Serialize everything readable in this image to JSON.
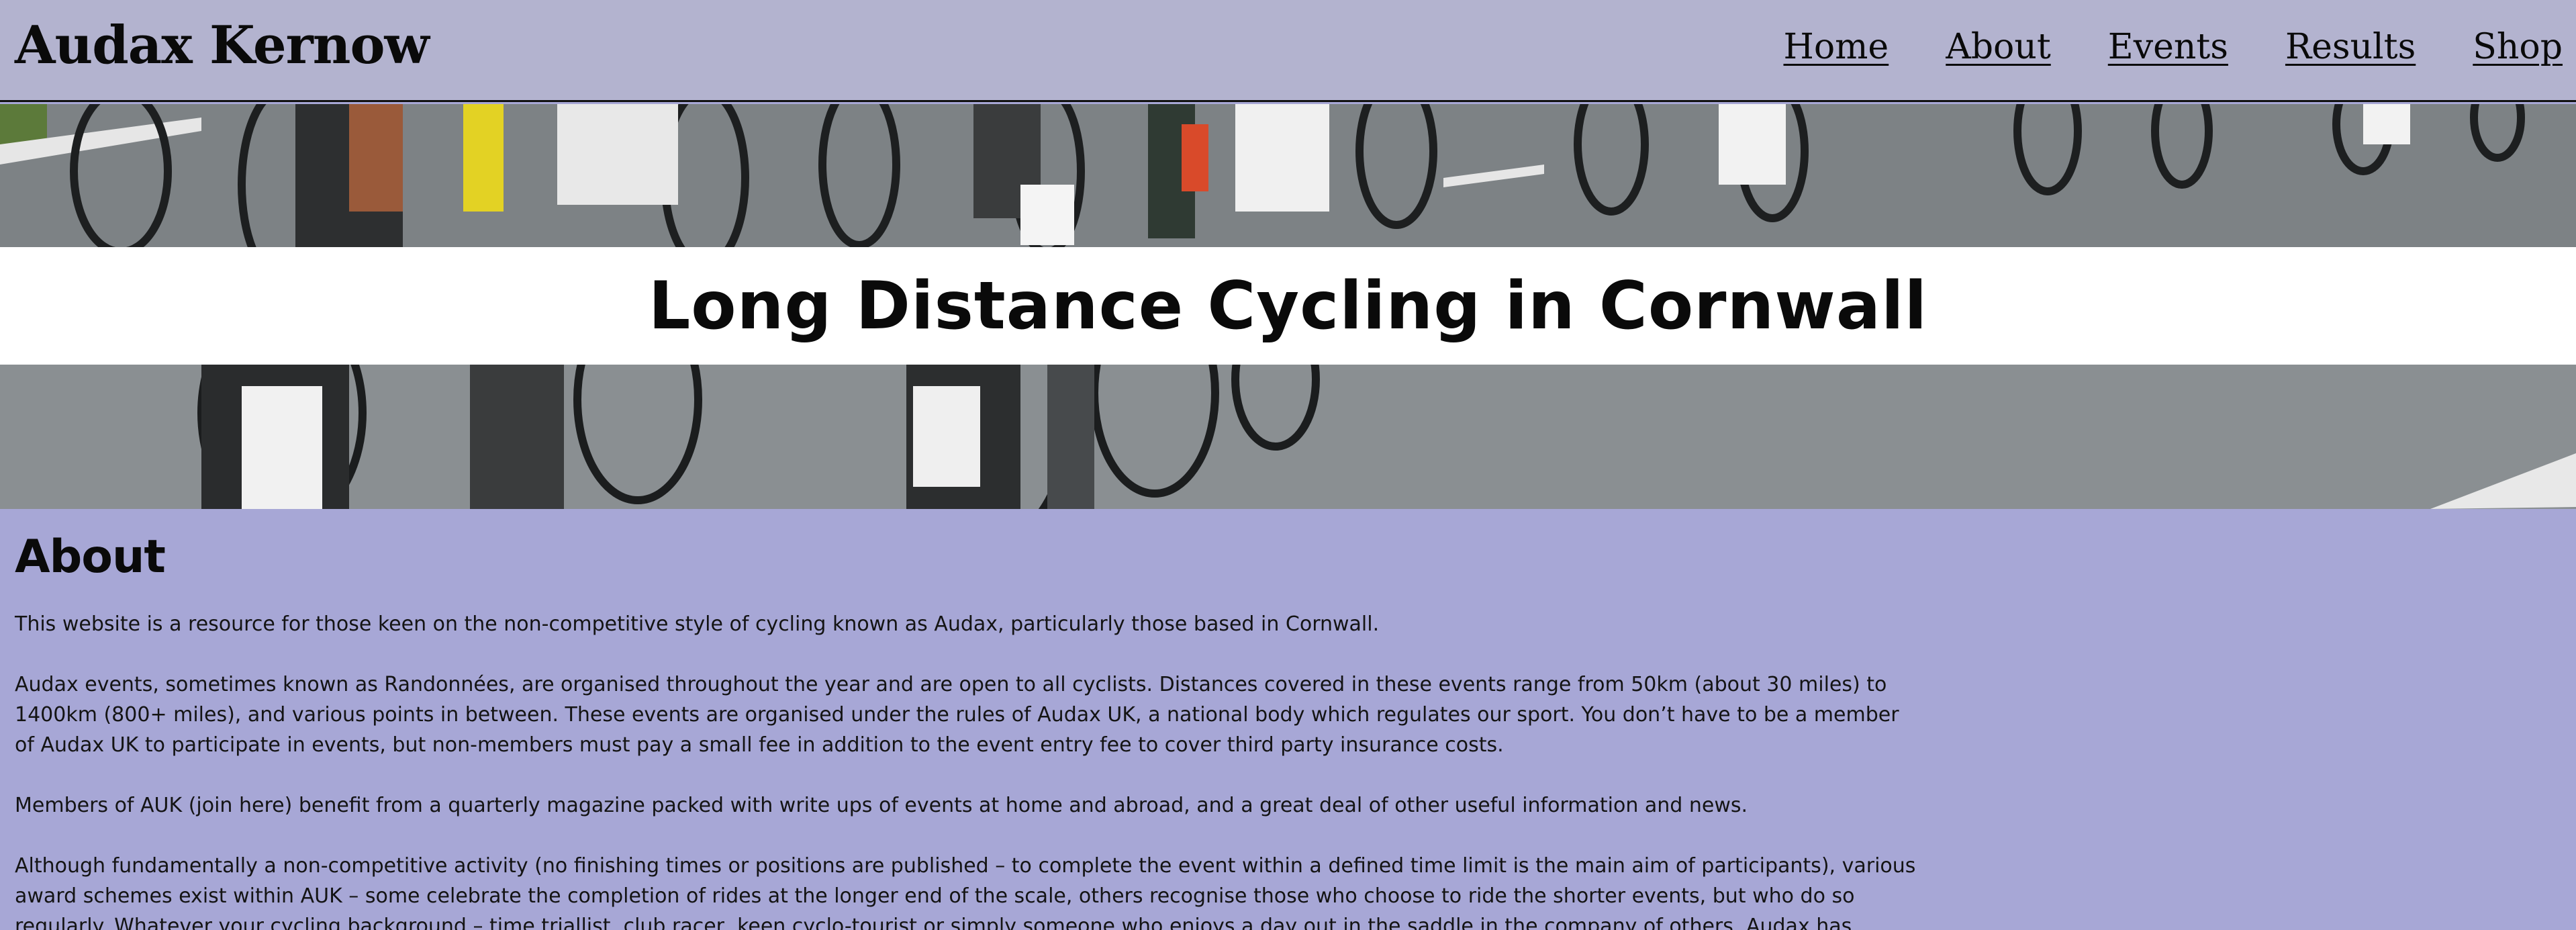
{
  "header": {
    "brand": "Audax Kernow",
    "nav": [
      "Home",
      "About",
      "Events",
      "Results",
      "Shop"
    ]
  },
  "hero": {
    "title": "Long Distance Cycling in Cornwall"
  },
  "about": {
    "heading": "About",
    "paragraphs": [
      "This website is a resource for those keen on the non-competitive style of cycling known as Audax, particularly those based in Cornwall.",
      "Audax events, sometimes known as Randonnées, are organised throughout the year and are open to all cyclists. Distances covered in these events range from 50km (about 30 miles) to 1400km (800+ miles), and various points in between. These events are organised under the rules of Audax UK, a national body which regulates our sport. You don’t have to be a member of Audax UK to participate in events, but non-members must pay a small fee in addition to the event entry fee to cover third party insurance costs.",
      "Members of AUK (join here) benefit from a quarterly magazine packed with write ups of events at home and abroad, and a great deal of other useful information and news.",
      "Although fundamentally a non-competitive activity (no finishing times or positions are published – to complete the event within a defined time limit is the main aim of participants), various award schemes exist within AUK – some celebrate the completion of rides at the longer end of the scale, others recognise those who choose to ride the shorter events, but who do so regularly. Whatever your cycling background – time triallist, club racer, keen cyclo-tourist or simply someone who enjoys a day out in the saddle in the company of others, Audax has"
    ]
  },
  "colors": {
    "header_bg": "#b3b3cf",
    "page_bg": "#a7a7d6",
    "hero_band_bg": "#ffffff"
  }
}
